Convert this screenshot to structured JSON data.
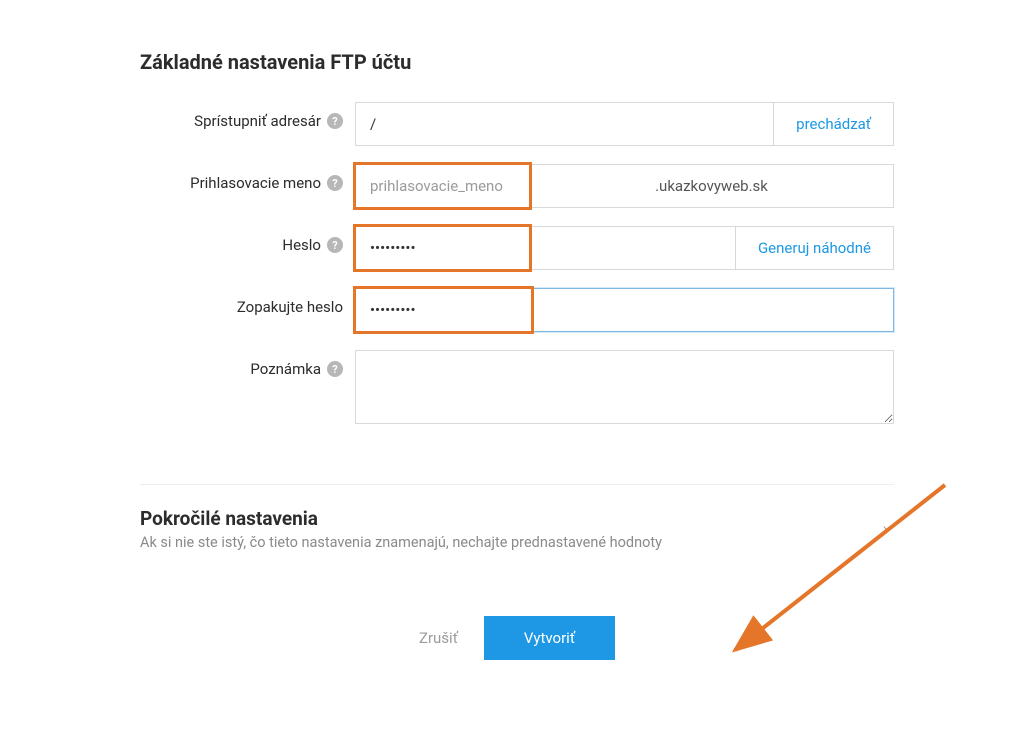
{
  "section_title": "Základné nastavenia FTP účtu",
  "fields": {
    "directory": {
      "label": "Sprístupniť adresár",
      "value": "/",
      "browse_label": "prechádzať"
    },
    "login": {
      "label": "Prihlasovacie meno",
      "placeholder": "prihlasovacie_meno",
      "value": "",
      "domain_suffix": ".ukazkovyweb.sk"
    },
    "password": {
      "label": "Heslo",
      "value": "•••••••••",
      "generate_label": "Generuj náhodné"
    },
    "password_repeat": {
      "label": "Zopakujte heslo",
      "value": "•••••••••"
    },
    "note": {
      "label": "Poznámka",
      "value": ""
    }
  },
  "advanced": {
    "title": "Pokročilé nastavenia",
    "subtitle": "Ak si nie ste istý, čo tieto nastavenia znamenajú, nechajte prednastavené hodnoty"
  },
  "actions": {
    "cancel": "Zrušiť",
    "create": "Vytvoriť"
  }
}
